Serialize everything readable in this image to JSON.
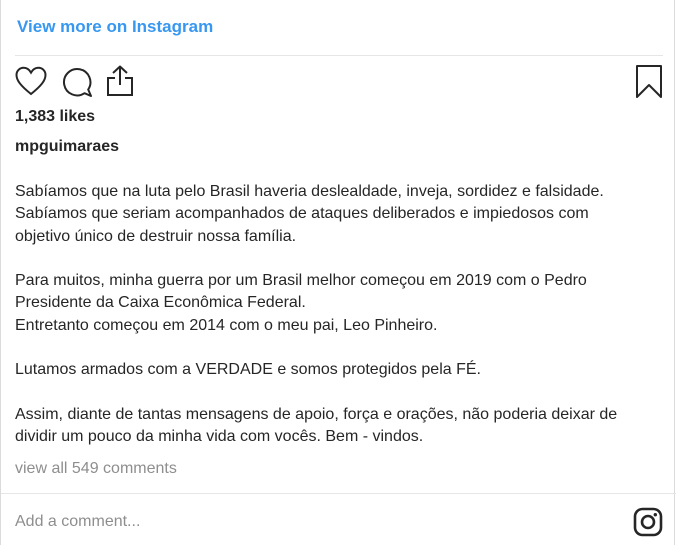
{
  "header": {
    "view_more_label": "View more on Instagram"
  },
  "actions": {
    "like_icon": "heart-icon",
    "comment_icon": "comment-icon",
    "share_icon": "share-icon",
    "save_icon": "bookmark-icon"
  },
  "post": {
    "likes": "1,383 likes",
    "username": "mpguimaraes",
    "caption_lines": [
      "Sabíamos que na luta pelo Brasil haveria deslealdade, inveja, sordidez e falsidade.",
      "Sabíamos que seriam acompanhados de ataques deliberados e impiedosos com",
      "objetivo único de destruir nossa família.",
      "",
      "Para muitos, minha guerra por um Brasil melhor começou em 2019 com o Pedro",
      "Presidente da Caixa Econômica Federal.",
      "Entretanto começou em 2014 com o meu pai, Leo Pinheiro.",
      "",
      "Lutamos armados com a VERDADE e somos protegidos pela FÉ.",
      "",
      "Assim, diante de tantas mensagens de apoio, força e orações, não poderia deixar de",
      "dividir um pouco da minha vida com vocês. Bem - vindos."
    ],
    "view_comments": "view all 549 comments"
  },
  "footer": {
    "add_comment_placeholder": "Add a comment...",
    "logo_icon": "instagram-icon"
  },
  "colors": {
    "link_blue": "#3897f0",
    "text": "#262626",
    "muted": "#8e8e8e",
    "divider": "#e6e6e6"
  }
}
